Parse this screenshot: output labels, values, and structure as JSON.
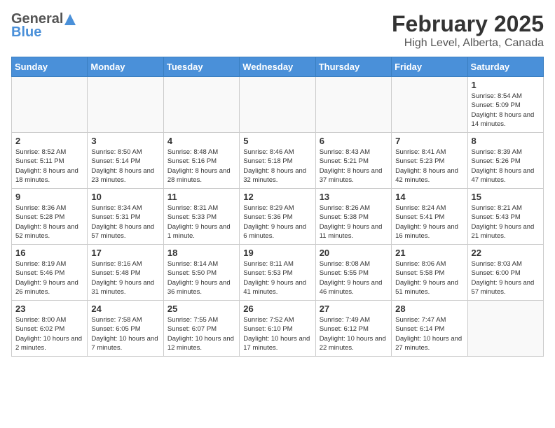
{
  "header": {
    "logo_general": "General",
    "logo_blue": "Blue",
    "month_title": "February 2025",
    "location": "High Level, Alberta, Canada"
  },
  "days_of_week": [
    "Sunday",
    "Monday",
    "Tuesday",
    "Wednesday",
    "Thursday",
    "Friday",
    "Saturday"
  ],
  "weeks": [
    [
      {
        "day": "",
        "info": ""
      },
      {
        "day": "",
        "info": ""
      },
      {
        "day": "",
        "info": ""
      },
      {
        "day": "",
        "info": ""
      },
      {
        "day": "",
        "info": ""
      },
      {
        "day": "",
        "info": ""
      },
      {
        "day": "1",
        "info": "Sunrise: 8:54 AM\nSunset: 5:09 PM\nDaylight: 8 hours and 14 minutes."
      }
    ],
    [
      {
        "day": "2",
        "info": "Sunrise: 8:52 AM\nSunset: 5:11 PM\nDaylight: 8 hours and 18 minutes."
      },
      {
        "day": "3",
        "info": "Sunrise: 8:50 AM\nSunset: 5:14 PM\nDaylight: 8 hours and 23 minutes."
      },
      {
        "day": "4",
        "info": "Sunrise: 8:48 AM\nSunset: 5:16 PM\nDaylight: 8 hours and 28 minutes."
      },
      {
        "day": "5",
        "info": "Sunrise: 8:46 AM\nSunset: 5:18 PM\nDaylight: 8 hours and 32 minutes."
      },
      {
        "day": "6",
        "info": "Sunrise: 8:43 AM\nSunset: 5:21 PM\nDaylight: 8 hours and 37 minutes."
      },
      {
        "day": "7",
        "info": "Sunrise: 8:41 AM\nSunset: 5:23 PM\nDaylight: 8 hours and 42 minutes."
      },
      {
        "day": "8",
        "info": "Sunrise: 8:39 AM\nSunset: 5:26 PM\nDaylight: 8 hours and 47 minutes."
      }
    ],
    [
      {
        "day": "9",
        "info": "Sunrise: 8:36 AM\nSunset: 5:28 PM\nDaylight: 8 hours and 52 minutes."
      },
      {
        "day": "10",
        "info": "Sunrise: 8:34 AM\nSunset: 5:31 PM\nDaylight: 8 hours and 57 minutes."
      },
      {
        "day": "11",
        "info": "Sunrise: 8:31 AM\nSunset: 5:33 PM\nDaylight: 9 hours and 1 minute."
      },
      {
        "day": "12",
        "info": "Sunrise: 8:29 AM\nSunset: 5:36 PM\nDaylight: 9 hours and 6 minutes."
      },
      {
        "day": "13",
        "info": "Sunrise: 8:26 AM\nSunset: 5:38 PM\nDaylight: 9 hours and 11 minutes."
      },
      {
        "day": "14",
        "info": "Sunrise: 8:24 AM\nSunset: 5:41 PM\nDaylight: 9 hours and 16 minutes."
      },
      {
        "day": "15",
        "info": "Sunrise: 8:21 AM\nSunset: 5:43 PM\nDaylight: 9 hours and 21 minutes."
      }
    ],
    [
      {
        "day": "16",
        "info": "Sunrise: 8:19 AM\nSunset: 5:46 PM\nDaylight: 9 hours and 26 minutes."
      },
      {
        "day": "17",
        "info": "Sunrise: 8:16 AM\nSunset: 5:48 PM\nDaylight: 9 hours and 31 minutes."
      },
      {
        "day": "18",
        "info": "Sunrise: 8:14 AM\nSunset: 5:50 PM\nDaylight: 9 hours and 36 minutes."
      },
      {
        "day": "19",
        "info": "Sunrise: 8:11 AM\nSunset: 5:53 PM\nDaylight: 9 hours and 41 minutes."
      },
      {
        "day": "20",
        "info": "Sunrise: 8:08 AM\nSunset: 5:55 PM\nDaylight: 9 hours and 46 minutes."
      },
      {
        "day": "21",
        "info": "Sunrise: 8:06 AM\nSunset: 5:58 PM\nDaylight: 9 hours and 51 minutes."
      },
      {
        "day": "22",
        "info": "Sunrise: 8:03 AM\nSunset: 6:00 PM\nDaylight: 9 hours and 57 minutes."
      }
    ],
    [
      {
        "day": "23",
        "info": "Sunrise: 8:00 AM\nSunset: 6:02 PM\nDaylight: 10 hours and 2 minutes."
      },
      {
        "day": "24",
        "info": "Sunrise: 7:58 AM\nSunset: 6:05 PM\nDaylight: 10 hours and 7 minutes."
      },
      {
        "day": "25",
        "info": "Sunrise: 7:55 AM\nSunset: 6:07 PM\nDaylight: 10 hours and 12 minutes."
      },
      {
        "day": "26",
        "info": "Sunrise: 7:52 AM\nSunset: 6:10 PM\nDaylight: 10 hours and 17 minutes."
      },
      {
        "day": "27",
        "info": "Sunrise: 7:49 AM\nSunset: 6:12 PM\nDaylight: 10 hours and 22 minutes."
      },
      {
        "day": "28",
        "info": "Sunrise: 7:47 AM\nSunset: 6:14 PM\nDaylight: 10 hours and 27 minutes."
      },
      {
        "day": "",
        "info": ""
      }
    ]
  ]
}
